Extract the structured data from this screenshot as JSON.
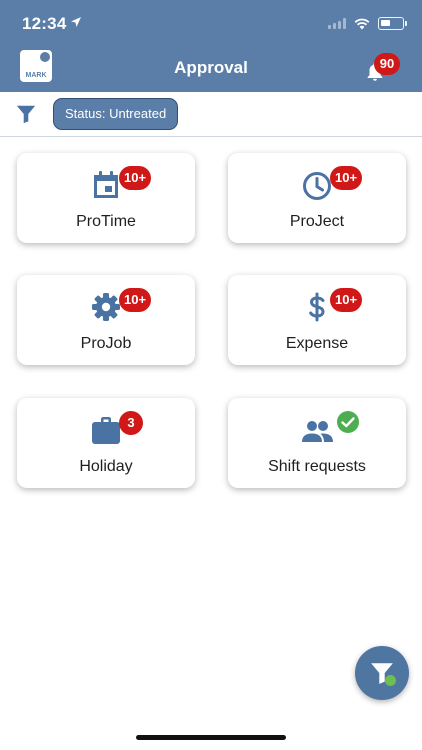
{
  "status_bar": {
    "time": "12:34"
  },
  "header": {
    "logo_text": "MARK",
    "title": "Approval",
    "notification_count": "90"
  },
  "filter": {
    "chip_label": "Status: Untreated"
  },
  "tiles": [
    {
      "label": "ProTime",
      "badge": "10+",
      "icon": "calendar-icon"
    },
    {
      "label": "ProJect",
      "badge": "10+",
      "icon": "clock-icon"
    },
    {
      "label": "ProJob",
      "badge": "10+",
      "icon": "gear-icon"
    },
    {
      "label": "Expense",
      "badge": "10+",
      "icon": "dollar-icon"
    },
    {
      "label": "Holiday",
      "badge": "3",
      "icon": "briefcase-icon"
    },
    {
      "label": "Shift requests",
      "badge": "",
      "icon": "people-icon",
      "status_icon": "check-circle-icon"
    }
  ],
  "colors": {
    "header_bg": "#5b7ea8",
    "icon_blue": "#4a72a3",
    "badge_red": "#d01818",
    "check_green": "#4cae50"
  }
}
